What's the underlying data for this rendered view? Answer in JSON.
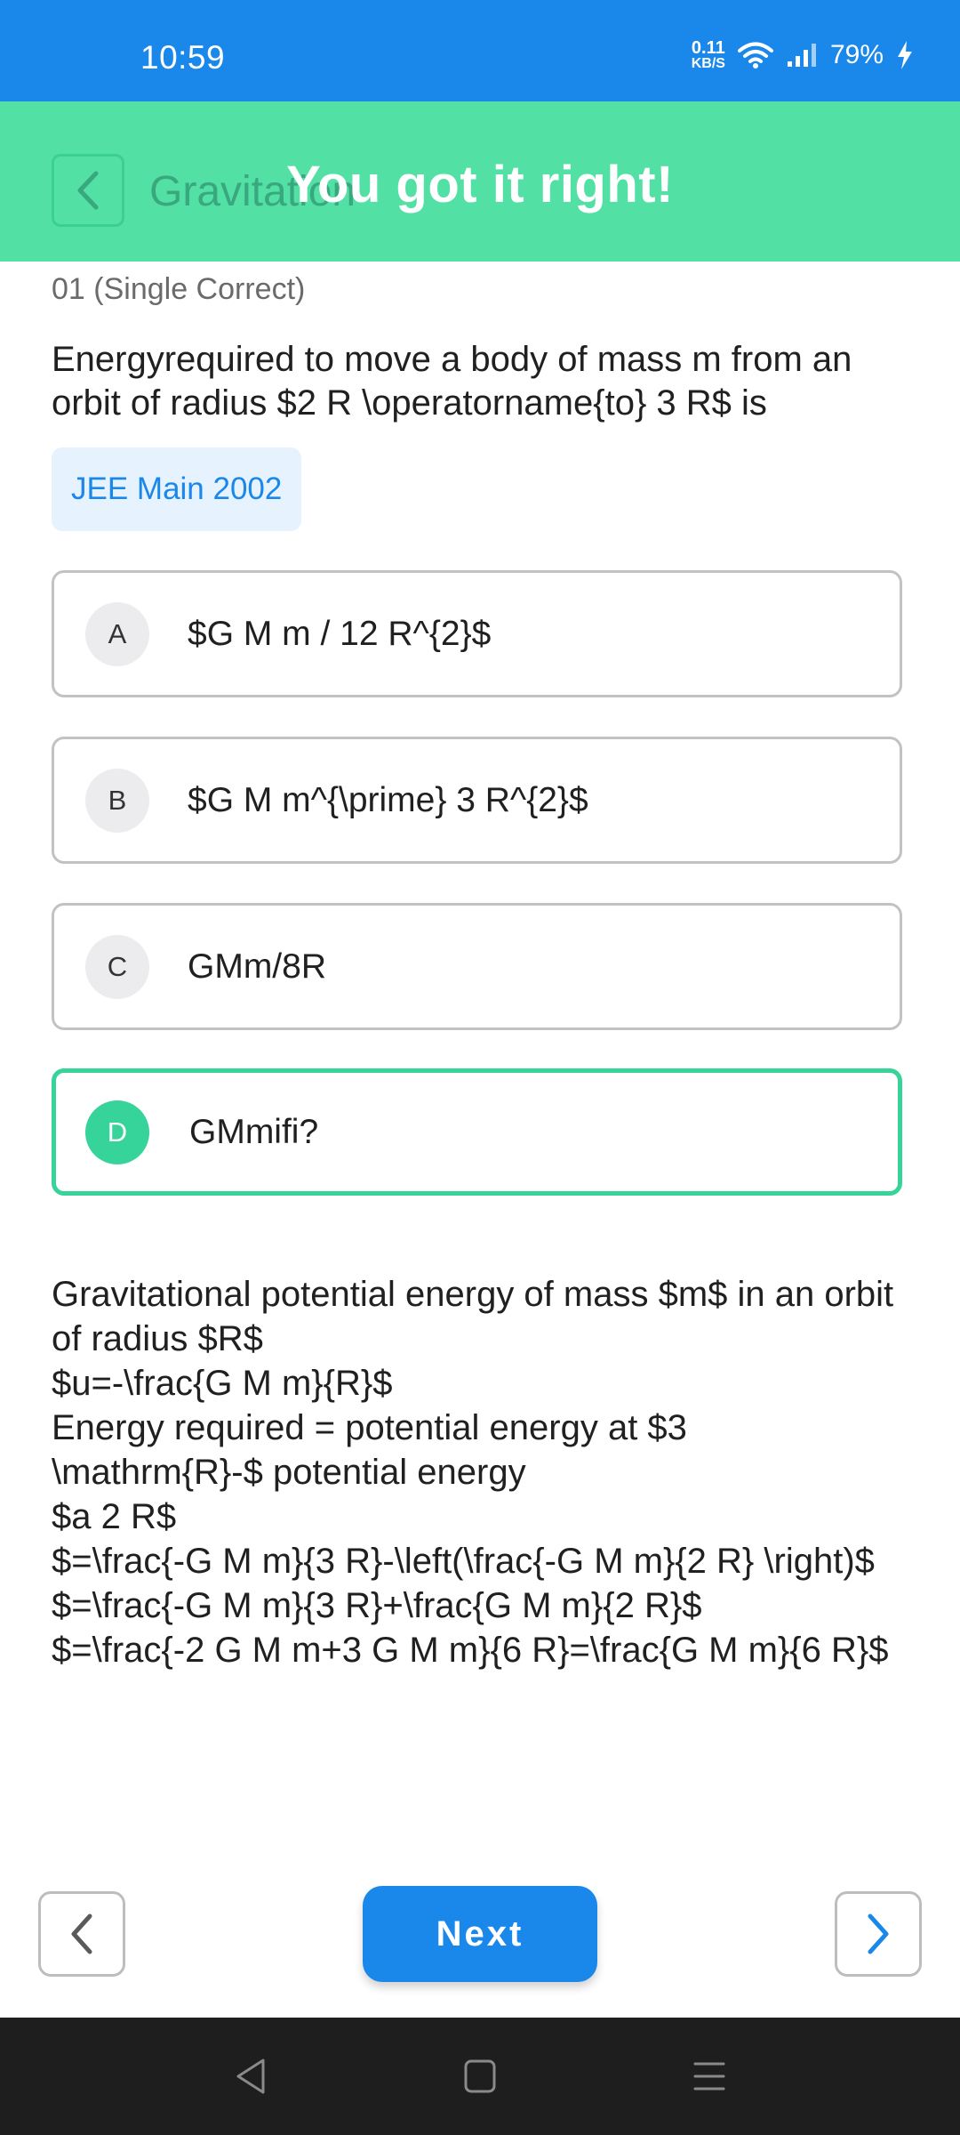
{
  "status_bar": {
    "time": "10:59",
    "net_speed_value": "0.11",
    "net_speed_unit": "KB/S",
    "battery": "79%",
    "icons": [
      "wifi-icon",
      "signal-icon",
      "charging-icon"
    ]
  },
  "header": {
    "title": "Gravitation",
    "toast": "You got it right!",
    "back_icon": "chevron-left-icon"
  },
  "question": {
    "meta": "01 (Single Correct)",
    "text": "Energyrequired to move a body of mass m from an orbit of radius $2 R \\operatorname{to} 3 R$ is",
    "tag": "JEE Main 2002"
  },
  "options": [
    {
      "letter": "A",
      "text": "$G M m / 12 R^{2}$"
    },
    {
      "letter": "B",
      "text": "$G M m^{\\prime} 3 R^{2}$"
    },
    {
      "letter": "C",
      "text": "GMm/8R"
    },
    {
      "letter": "D",
      "text": "GMmifi?"
    }
  ],
  "solution": [
    "Gravitational potential energy of mass $m$ in an orbit of radius $R$",
    "$u=-\\frac{G M m}{R}$",
    "Energy required = potential energy at $3 \\mathrm{R}-$ potential energy",
    "$a 2 R$",
    "$=\\frac{-G M m}{3 R}-\\left(\\frac{-G M m}{2 R} \\right)$",
    "$=\\frac{-G M m}{3 R}+\\frac{G M m}{2 R}$",
    "$=\\frac{-2 G M m+3 G M m}{6 R}=\\frac{G M m}{6 R}$"
  ],
  "bottom_nav": {
    "next_label": "Next",
    "prev_icon": "chevron-left-icon",
    "forward_icon": "chevron-right-icon"
  },
  "colors": {
    "status_bar": "#1a88ea",
    "toast": "#52e0a5",
    "correct": "#36d39a",
    "accent": "#1a88ea"
  }
}
